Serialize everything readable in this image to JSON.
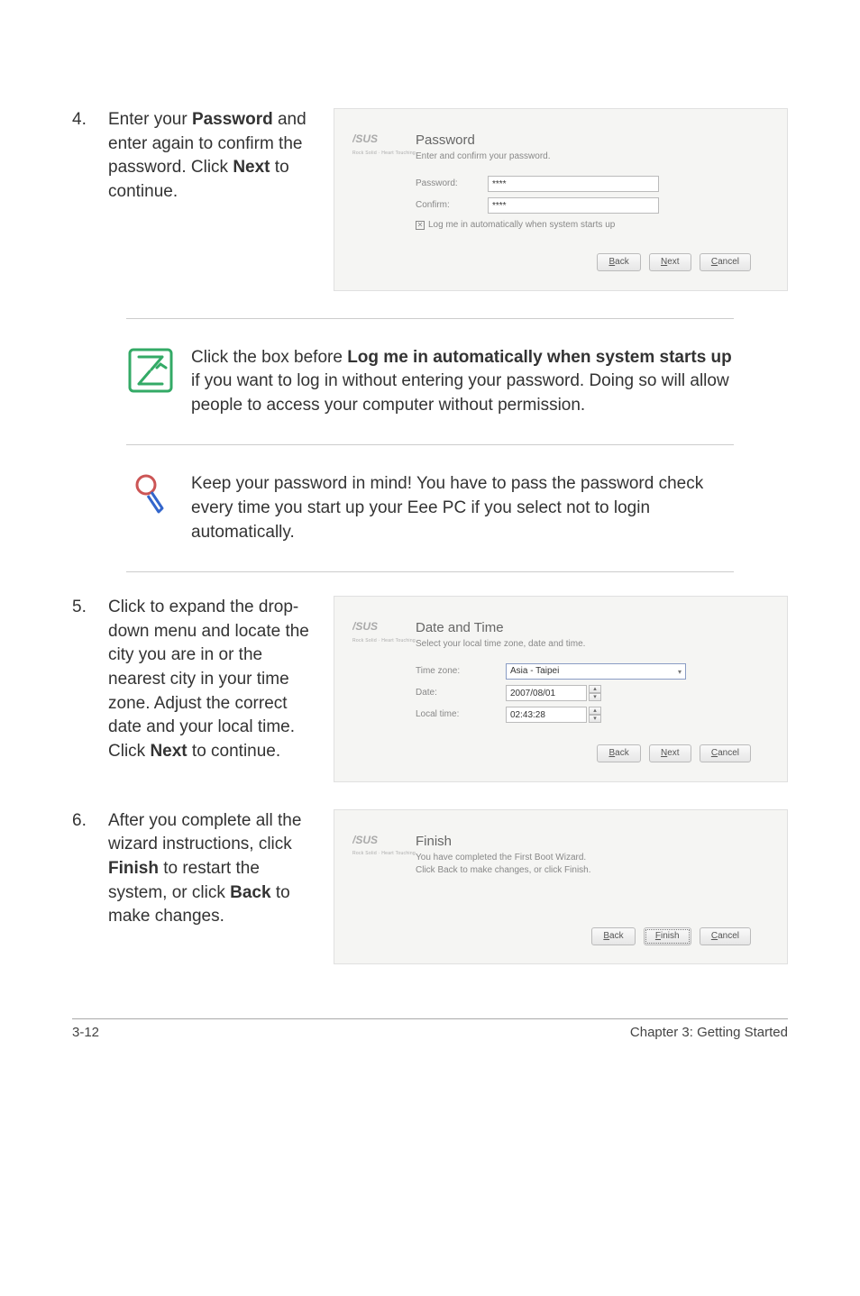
{
  "steps": {
    "s4": {
      "num": "4.",
      "body_parts": [
        "Enter your ",
        "Password",
        " and enter again to confirm the password. Click ",
        "Next",
        " to continue."
      ]
    },
    "s5": {
      "num": "5.",
      "body_parts": [
        "Click to expand the drop-down menu and locate the city you are in or the nearest city in your time zone. Adjust the correct date and your local time. Click ",
        "Next",
        " to continue."
      ]
    },
    "s6": {
      "num": "6.",
      "body_parts": [
        "After you complete all the wizard instructions, click ",
        "Finish",
        " to restart the system, or click ",
        "Back",
        " to make changes."
      ]
    }
  },
  "dialogs": {
    "password": {
      "title": "Password",
      "sub": "Enter and confirm your password.",
      "pw_label": "Password:",
      "pw_value": "****",
      "cf_label": "Confirm:",
      "cf_value": "****",
      "auto_label": "Log me in automatically when system starts up",
      "btn_back": "Back",
      "btn_next": "Next",
      "btn_cancel": "Cancel"
    },
    "datetime": {
      "title": "Date and Time",
      "sub": "Select your local time zone, date and time.",
      "tz_label": "Time zone:",
      "tz_value": "Asia - Taipei",
      "date_label": "Date:",
      "date_value": "2007/08/01",
      "time_label": "Local time:",
      "time_value": "02:43:28",
      "btn_back": "Back",
      "btn_next": "Next",
      "btn_cancel": "Cancel"
    },
    "finish": {
      "title": "Finish",
      "sub1": "You have completed the First Boot Wizard.",
      "sub2": "Click Back to make changes, or click Finish.",
      "btn_back": "Back",
      "btn_finish": "Finish",
      "btn_cancel": "Cancel"
    }
  },
  "notes": {
    "n1_parts": [
      "Click the box before ",
      "Log me in automatically when system starts up",
      " if you want to log in without entering your password. Doing so will allow people to access your computer without permission."
    ],
    "n2": "Keep your password in mind! You have to pass the password check every time you start up your Eee PC if you select not to login automatically."
  },
  "footer": {
    "left": "3-12",
    "right": "Chapter 3: Getting Started"
  }
}
